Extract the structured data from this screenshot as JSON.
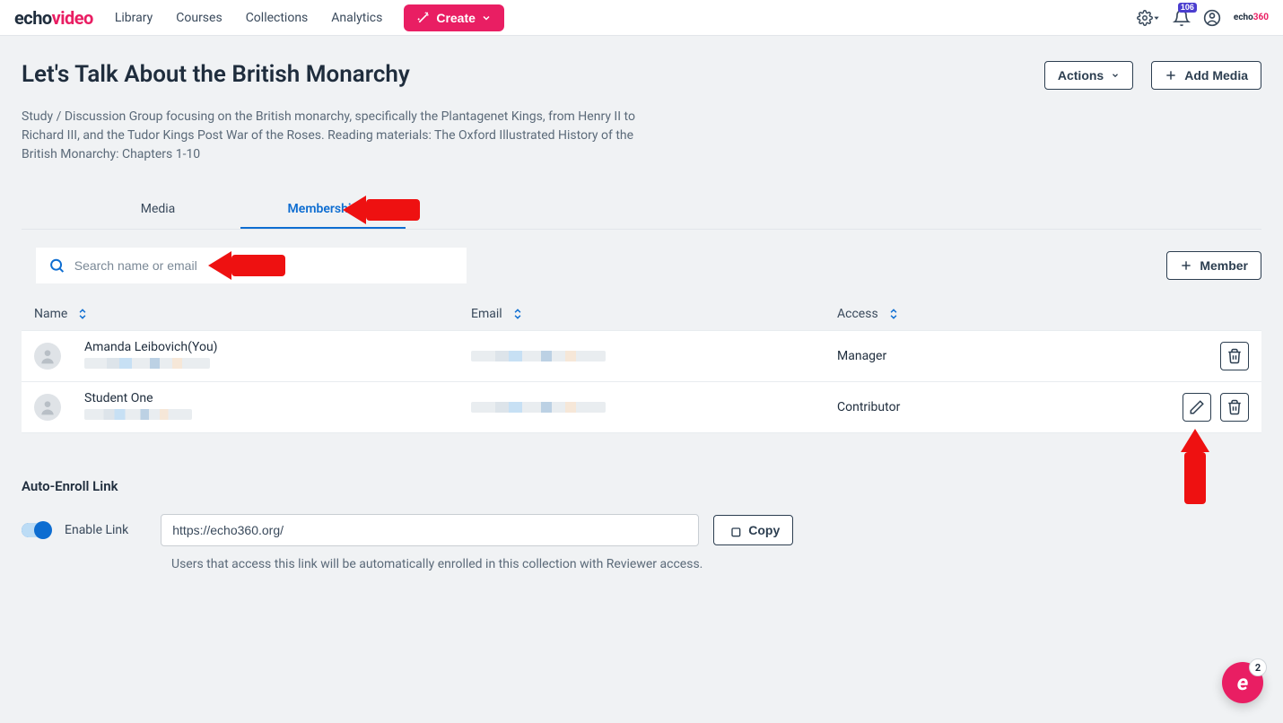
{
  "topbar": {
    "nav": [
      "Library",
      "Courses",
      "Collections",
      "Analytics"
    ],
    "create_label": "Create",
    "notification_count": "106"
  },
  "page": {
    "title": "Let's Talk About the British Monarchy",
    "description": "Study / Discussion Group focusing on the British monarchy, specifically the Plantagenet Kings, from Henry II to Richard III, and the Tudor Kings Post War of the Roses. Reading materials: The Oxford Illustrated History of the British Monarchy: Chapters 1-10",
    "actions_label": "Actions",
    "add_media_label": "Add Media"
  },
  "tabs": {
    "media": "Media",
    "membership": "Membership"
  },
  "search": {
    "placeholder": "Search name or email"
  },
  "member_button": "Member",
  "columns": {
    "name": "Name",
    "email": "Email",
    "access": "Access"
  },
  "members": [
    {
      "name": "Amanda Leibovich(You)",
      "access": "Manager",
      "editable": false
    },
    {
      "name": "Student One",
      "access": "Contributor",
      "editable": true
    }
  ],
  "auto_enroll": {
    "heading": "Auto-Enroll Link",
    "toggle_label": "Enable Link",
    "url": "https://echo360.org/",
    "copy_label": "Copy",
    "note": "Users that access this link will be automatically enrolled in this collection with Reviewer access."
  },
  "fab": {
    "badge": "2"
  }
}
